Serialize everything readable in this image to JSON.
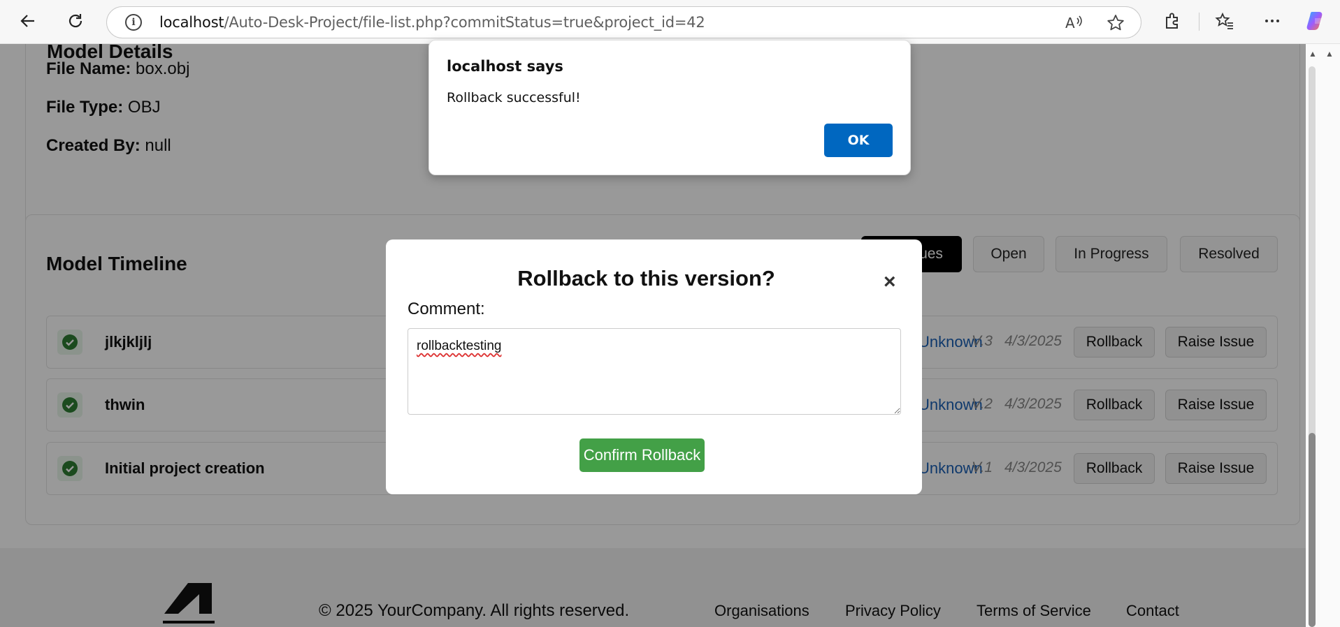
{
  "browser": {
    "url_host": "localhost",
    "url_path": "/Auto-Desk-Project/file-list.php?commitStatus=true&project_id=42"
  },
  "details": {
    "file_name_label": "File Name:",
    "file_name": "box.obj",
    "file_type_label": "File Type:",
    "file_type": "OBJ",
    "created_by_label": "Created By:",
    "created_by": "null"
  },
  "timeline": {
    "title": "Model Timeline",
    "filters": [
      {
        "label": "All Issues"
      },
      {
        "label": "Open"
      },
      {
        "label": "In Progress"
      },
      {
        "label": "Resolved"
      }
    ],
    "rows": [
      {
        "title": "jlkjkljlj",
        "author": "Unknown",
        "version": "V.3",
        "date": "4/3/2025"
      },
      {
        "title": "thwin",
        "author": "Unknown",
        "version": "V.2",
        "date": "4/3/2025"
      },
      {
        "title": "Initial project creation",
        "author": "Unknown",
        "version": "V.1",
        "date": "4/3/2025"
      }
    ],
    "rollback_label": "Rollback",
    "raise_issue_label": "Raise Issue"
  },
  "footer": {
    "copyright": "© 2025 YourCompany. All rights reserved.",
    "links": [
      "Organisations",
      "Privacy Policy",
      "Terms of Service",
      "Contact"
    ]
  },
  "modal": {
    "title": "Rollback to this version?",
    "close": "×",
    "comment_label": "Comment:",
    "comment_value": "rollbacktesting",
    "confirm_label": "Confirm Rollback"
  },
  "alert": {
    "title": "localhost says",
    "message": "Rollback successful!",
    "ok_label": "OK"
  },
  "colors": {
    "confirm": "#43a047",
    "ok": "#0067c0",
    "link": "#1a5fb4"
  }
}
